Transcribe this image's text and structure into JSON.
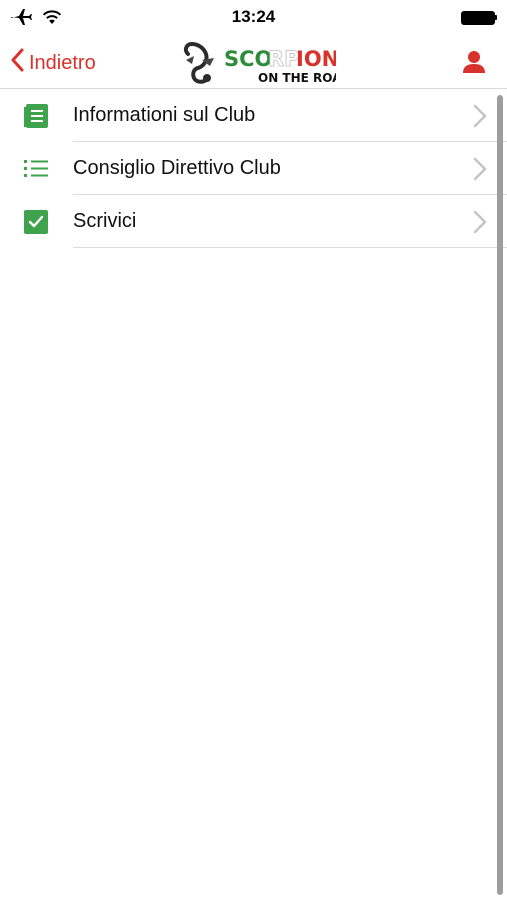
{
  "status_bar": {
    "time": "13:24",
    "icons": [
      "airplane-icon",
      "wifi-icon",
      "battery-icon"
    ]
  },
  "nav_bar": {
    "back_label": "Indietro",
    "logo": {
      "title_text": "SCORPIONI",
      "subtitle_text": "ON THE ROAD"
    },
    "right_icon": "user-icon"
  },
  "menu": {
    "items": [
      {
        "label": "Informationi sul Club",
        "icon": "document-icon"
      },
      {
        "label": "Consiglio Direttivo Club",
        "icon": "list-icon"
      },
      {
        "label": "Scrivici",
        "icon": "checkbox-icon"
      }
    ]
  },
  "colors": {
    "accent": "#d8322c",
    "icon_green": "#3fa34d",
    "separator": "#dcdcdc",
    "chevron": "#c4c4c4"
  }
}
